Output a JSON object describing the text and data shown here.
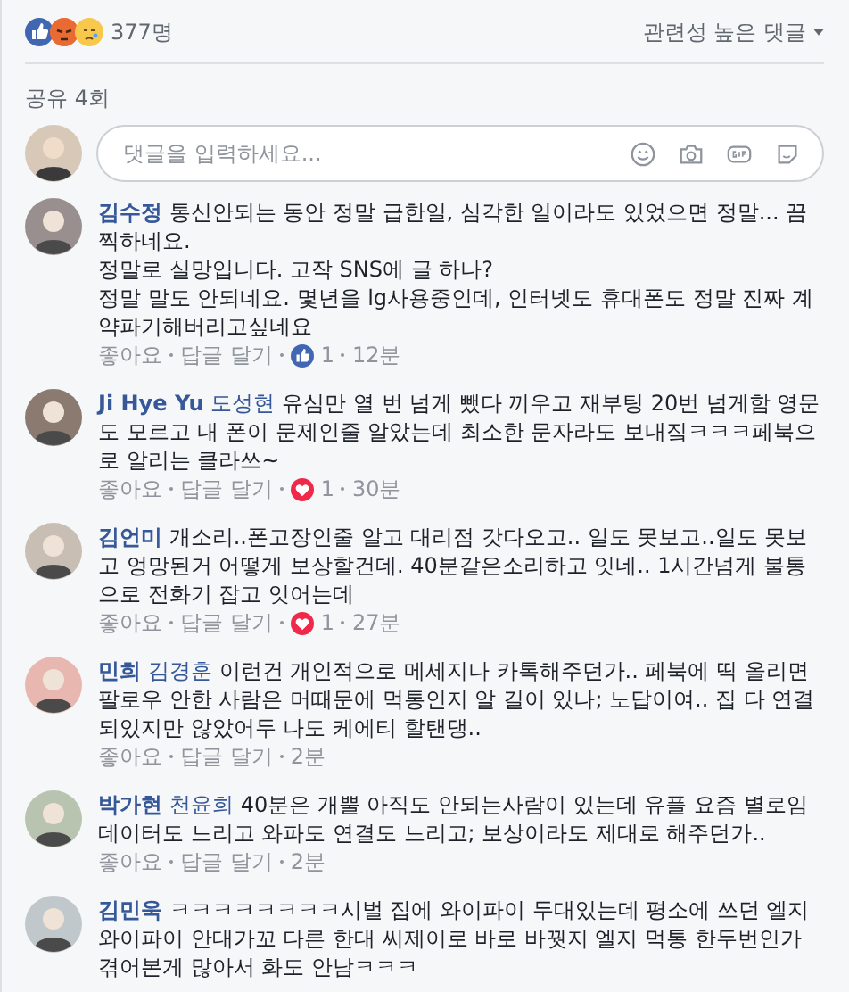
{
  "reactions": {
    "count": "377명"
  },
  "sort": {
    "label": "관련성 높은 댓글"
  },
  "shares": "공유 4회",
  "composer": {
    "placeholder": "댓글을 입력하세요..."
  },
  "comments": [
    {
      "author": "김수정",
      "lines": [
        "통신안되는 동안 정말 급한일, 심각한 일이라도 있었으면 정말... 끔찍하네요.",
        "정말로 실망입니다. 고작 SNS에 글 하나?",
        "정말 말도 안되네요. 몇년을 lg사용중인데, 인터넷도 휴대폰도 정말 진짜 계약파기해버리고싶네요"
      ],
      "like": "좋아요",
      "reply": "답글 달기",
      "reaction": {
        "kind": "like",
        "count": "1"
      },
      "time": "12분"
    },
    {
      "author": "Ji Hye Yu",
      "tag": "도성현",
      "lines": [
        "유심만 열 번 넘게 뺐다 끼우고 재부팅 20번 넘게함 영문도 모르고 내 폰이 문제인줄 알았는데 최소한 문자라도 보내짘ㅋㅋㅋ페북으로 알리는 클라쓰~"
      ],
      "like": "좋아요",
      "reply": "답글 달기",
      "reaction": {
        "kind": "love",
        "count": "1"
      },
      "time": "30분"
    },
    {
      "author": "김언미",
      "lines": [
        "개소리..폰고장인줄 알고 대리점 갓다오고.. 일도 못보고..일도 못보고 엉망된거 어떻게 보상할건데. 40분같은소리하고 잇네.. 1시간넘게 불통으로 전화기 잡고 잇어는데"
      ],
      "like": "좋아요",
      "reply": "답글 달기",
      "reaction": {
        "kind": "love",
        "count": "1"
      },
      "time": "27분"
    },
    {
      "author": "민희",
      "tag": "김경훈",
      "lines": [
        "이런건 개인적으로 메세지나 카톡해주던가.. 페북에 띡 올리면 팔로우 안한 사람은 머때문에 먹통인지 알 길이 있나; 노답이여.. 집 다 연결되있지만 않았어두 나도 케에티 할탠댕.."
      ],
      "like": "좋아요",
      "reply": "답글 달기",
      "time": "2분"
    },
    {
      "author": "박가현",
      "tag": "천윤희",
      "lines": [
        "40분은 개뿔 아직도 안되는사람이 있는데 유플 요즘 별로임 데이터도 느리고 와파도 연결도 느리고; 보상이라도 제대로 해주던가.."
      ],
      "like": "좋아요",
      "reply": "답글 달기",
      "time": "2분"
    },
    {
      "author": "김민욱",
      "lines": [
        "ㅋㅋㅋㅋㅋㅋㅋㅋ시벌 집에 와이파이 두대있는데 평소에 쓰던 엘지 와이파이 안대가꼬 다른 한대 씨제이로 바로 바꿧지 엘지 먹통 한두번인가 겪어본게 많아서 화도 안남ㅋㅋㅋ"
      ]
    }
  ]
}
